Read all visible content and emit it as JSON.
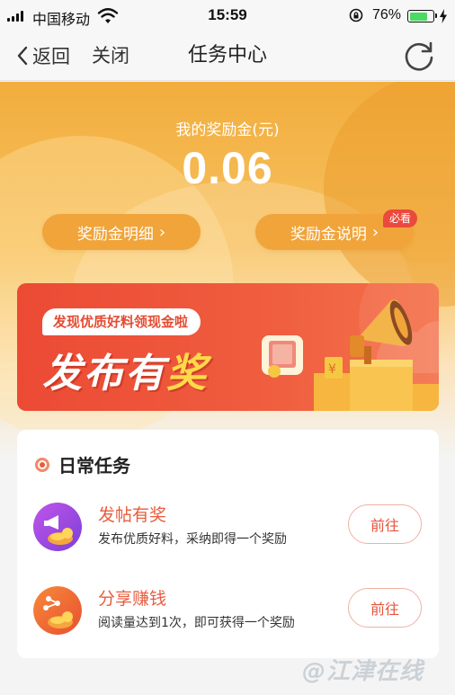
{
  "status_bar": {
    "carrier": "中国移动",
    "time": "15:59",
    "battery_percent": "76%",
    "battery_level": 0.76,
    "icons": [
      "signal-icon",
      "wifi-icon",
      "rotation-lock-icon",
      "battery-icon",
      "charging-bolt-icon"
    ]
  },
  "nav": {
    "back_label": "返回",
    "close_label": "关闭",
    "title": "任务中心",
    "refresh_icon": "refresh-icon"
  },
  "header": {
    "balance_label": "我的奖励金(元)",
    "balance_value": "0.06",
    "detail_button": "奖励金明细",
    "explain_button": "奖励金说明",
    "explain_badge": "必看",
    "chevron": "›"
  },
  "banner": {
    "tag": "发现优质好料领现金啦",
    "title_main": "发布有",
    "title_highlight": "奖",
    "art_icons": [
      "cash-envelope-icon",
      "megaphone-icon",
      "coin-icon"
    ]
  },
  "daily_tasks": {
    "heading": "日常任务",
    "tasks": [
      {
        "title": "发帖有奖",
        "description": "发布优质好料，采纳即得一个奖励",
        "button": "前往",
        "icon": "post-reward-icon"
      },
      {
        "title": "分享赚钱",
        "description": "阅读量达到1次，即可获得一个奖励",
        "button": "前往",
        "icon": "share-reward-icon"
      }
    ]
  },
  "watermark": "@江津在线",
  "colors": {
    "accent_red": "#e85c3e",
    "header_orange": "#f2ad3d",
    "pill_orange": "#f0a43a",
    "badge_red": "#ea4a3d",
    "battery_green": "#4cd964"
  }
}
